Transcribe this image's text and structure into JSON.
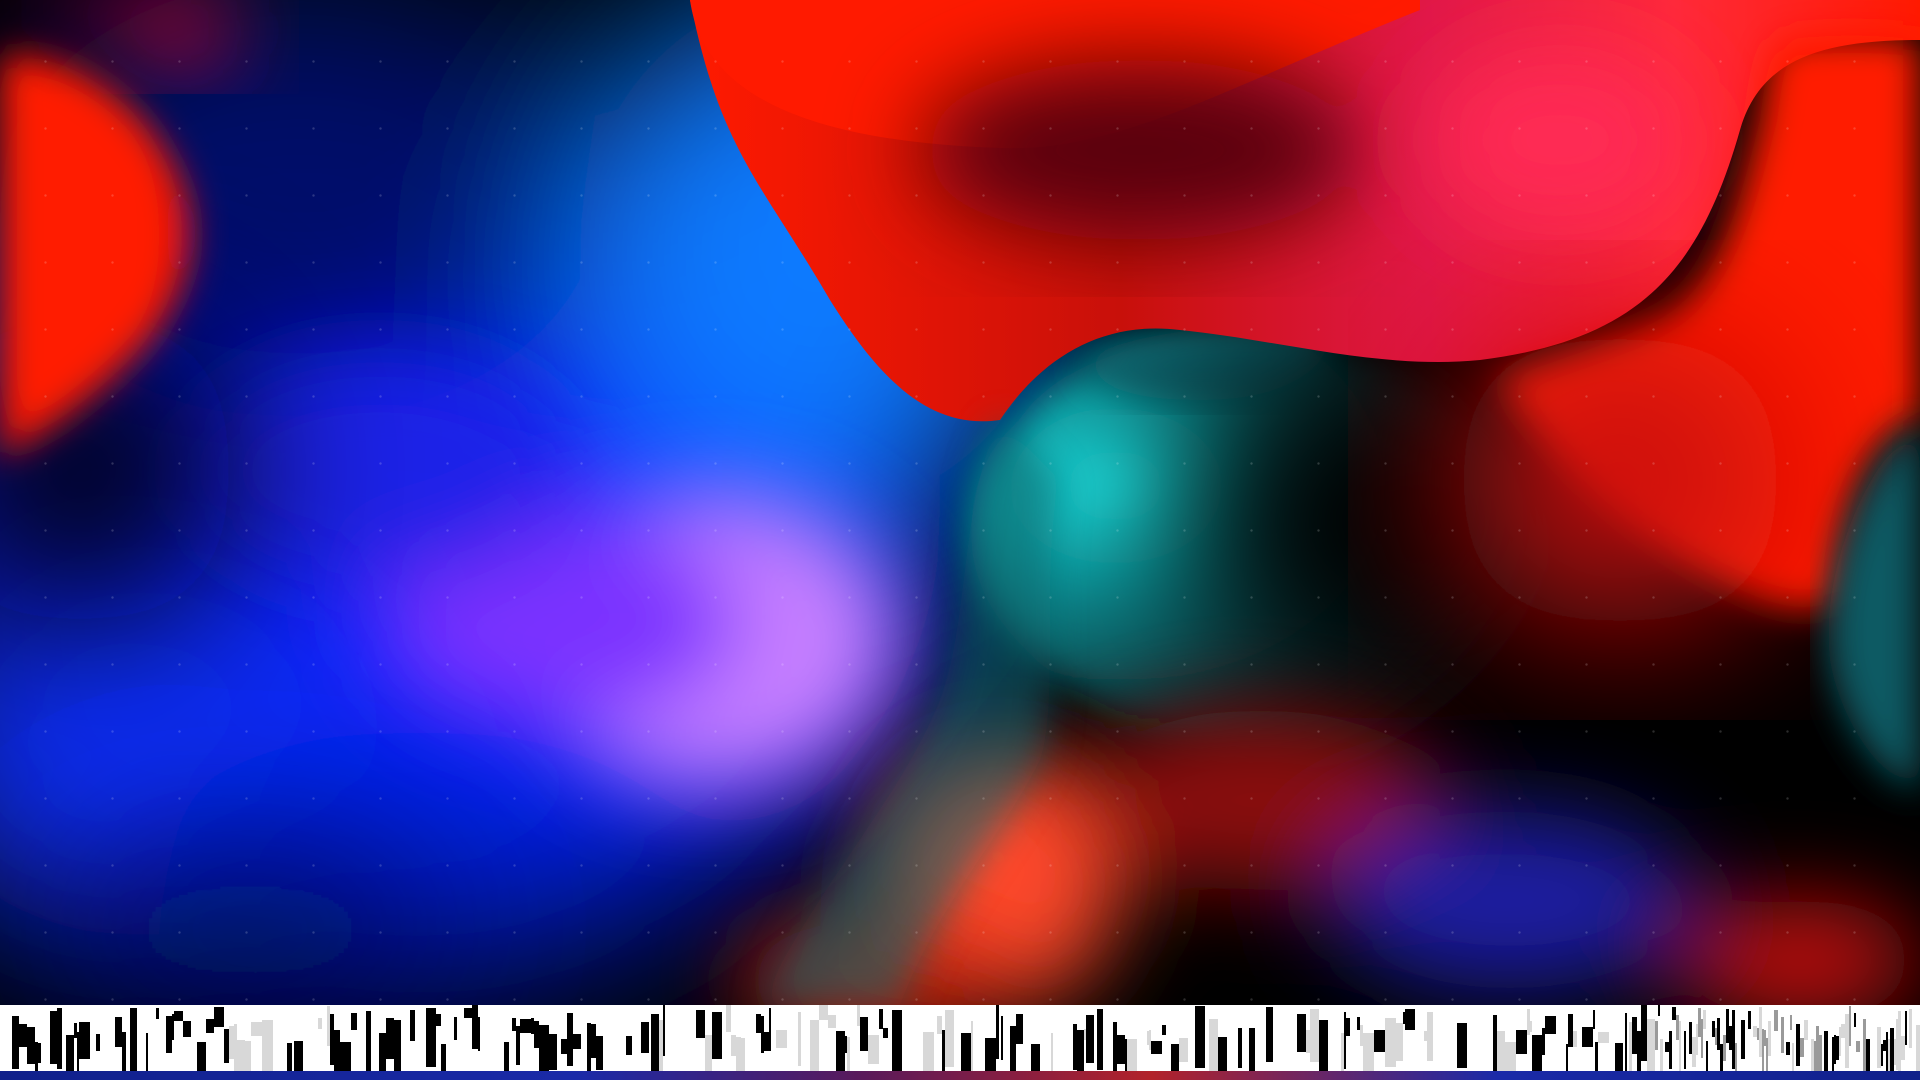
{
  "wallpaper": {
    "name": "abstract-fluid-wallpaper",
    "colors": {
      "red": "#ff1a00",
      "crimson": "#e01040",
      "blue": "#0a2aff",
      "deep_blue": "#0010a0",
      "navy": "#000a40",
      "violet": "#c070ff",
      "cyan": "#20e0e8",
      "teal": "#0a5a60",
      "black": "#000000"
    }
  },
  "glitch": {
    "name": "corrupted-pixel-strip",
    "colors": [
      "#ffffff",
      "#000000",
      "#9a9a9a",
      "#d8d8d8"
    ]
  },
  "bottom_bar": {
    "colors": [
      "#10208a",
      "#b2222a"
    ]
  }
}
